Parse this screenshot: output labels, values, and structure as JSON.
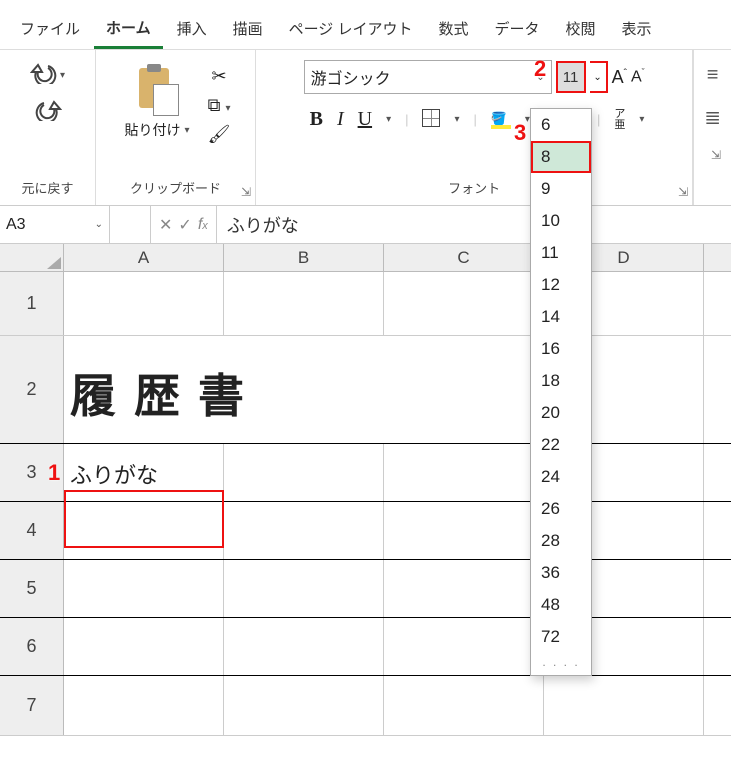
{
  "tabs": {
    "file": "ファイル",
    "home": "ホーム",
    "insert": "挿入",
    "draw": "描画",
    "layout": "ページ レイアウト",
    "formula": "数式",
    "data": "データ",
    "review": "校閲",
    "view": "表示"
  },
  "ribbon": {
    "undo_group": "元に戻す",
    "clipboard_group": "クリップボード",
    "paste_label": "貼り付け",
    "font_group": "フォント",
    "font_name": "游ゴシック",
    "font_size": "11",
    "bold": "B",
    "italic": "I",
    "underline": "U",
    "fontcolor_letter": "A",
    "ruby_top": "ア",
    "ruby_bottom": "亜"
  },
  "size_options": [
    "6",
    "8",
    "9",
    "10",
    "11",
    "12",
    "14",
    "16",
    "18",
    "20",
    "22",
    "24",
    "26",
    "28",
    "36",
    "48",
    "72"
  ],
  "name_box": "A3",
  "formula_value": "ふりがな",
  "columns": [
    "A",
    "B",
    "C",
    "D"
  ],
  "row_numbers": [
    "1",
    "2",
    "3",
    "4",
    "5",
    "6",
    "7"
  ],
  "cells": {
    "A2": "履歴書",
    "A3": "ふりがな"
  },
  "annotations": {
    "n1": "1",
    "n2": "2",
    "n3": "3"
  }
}
